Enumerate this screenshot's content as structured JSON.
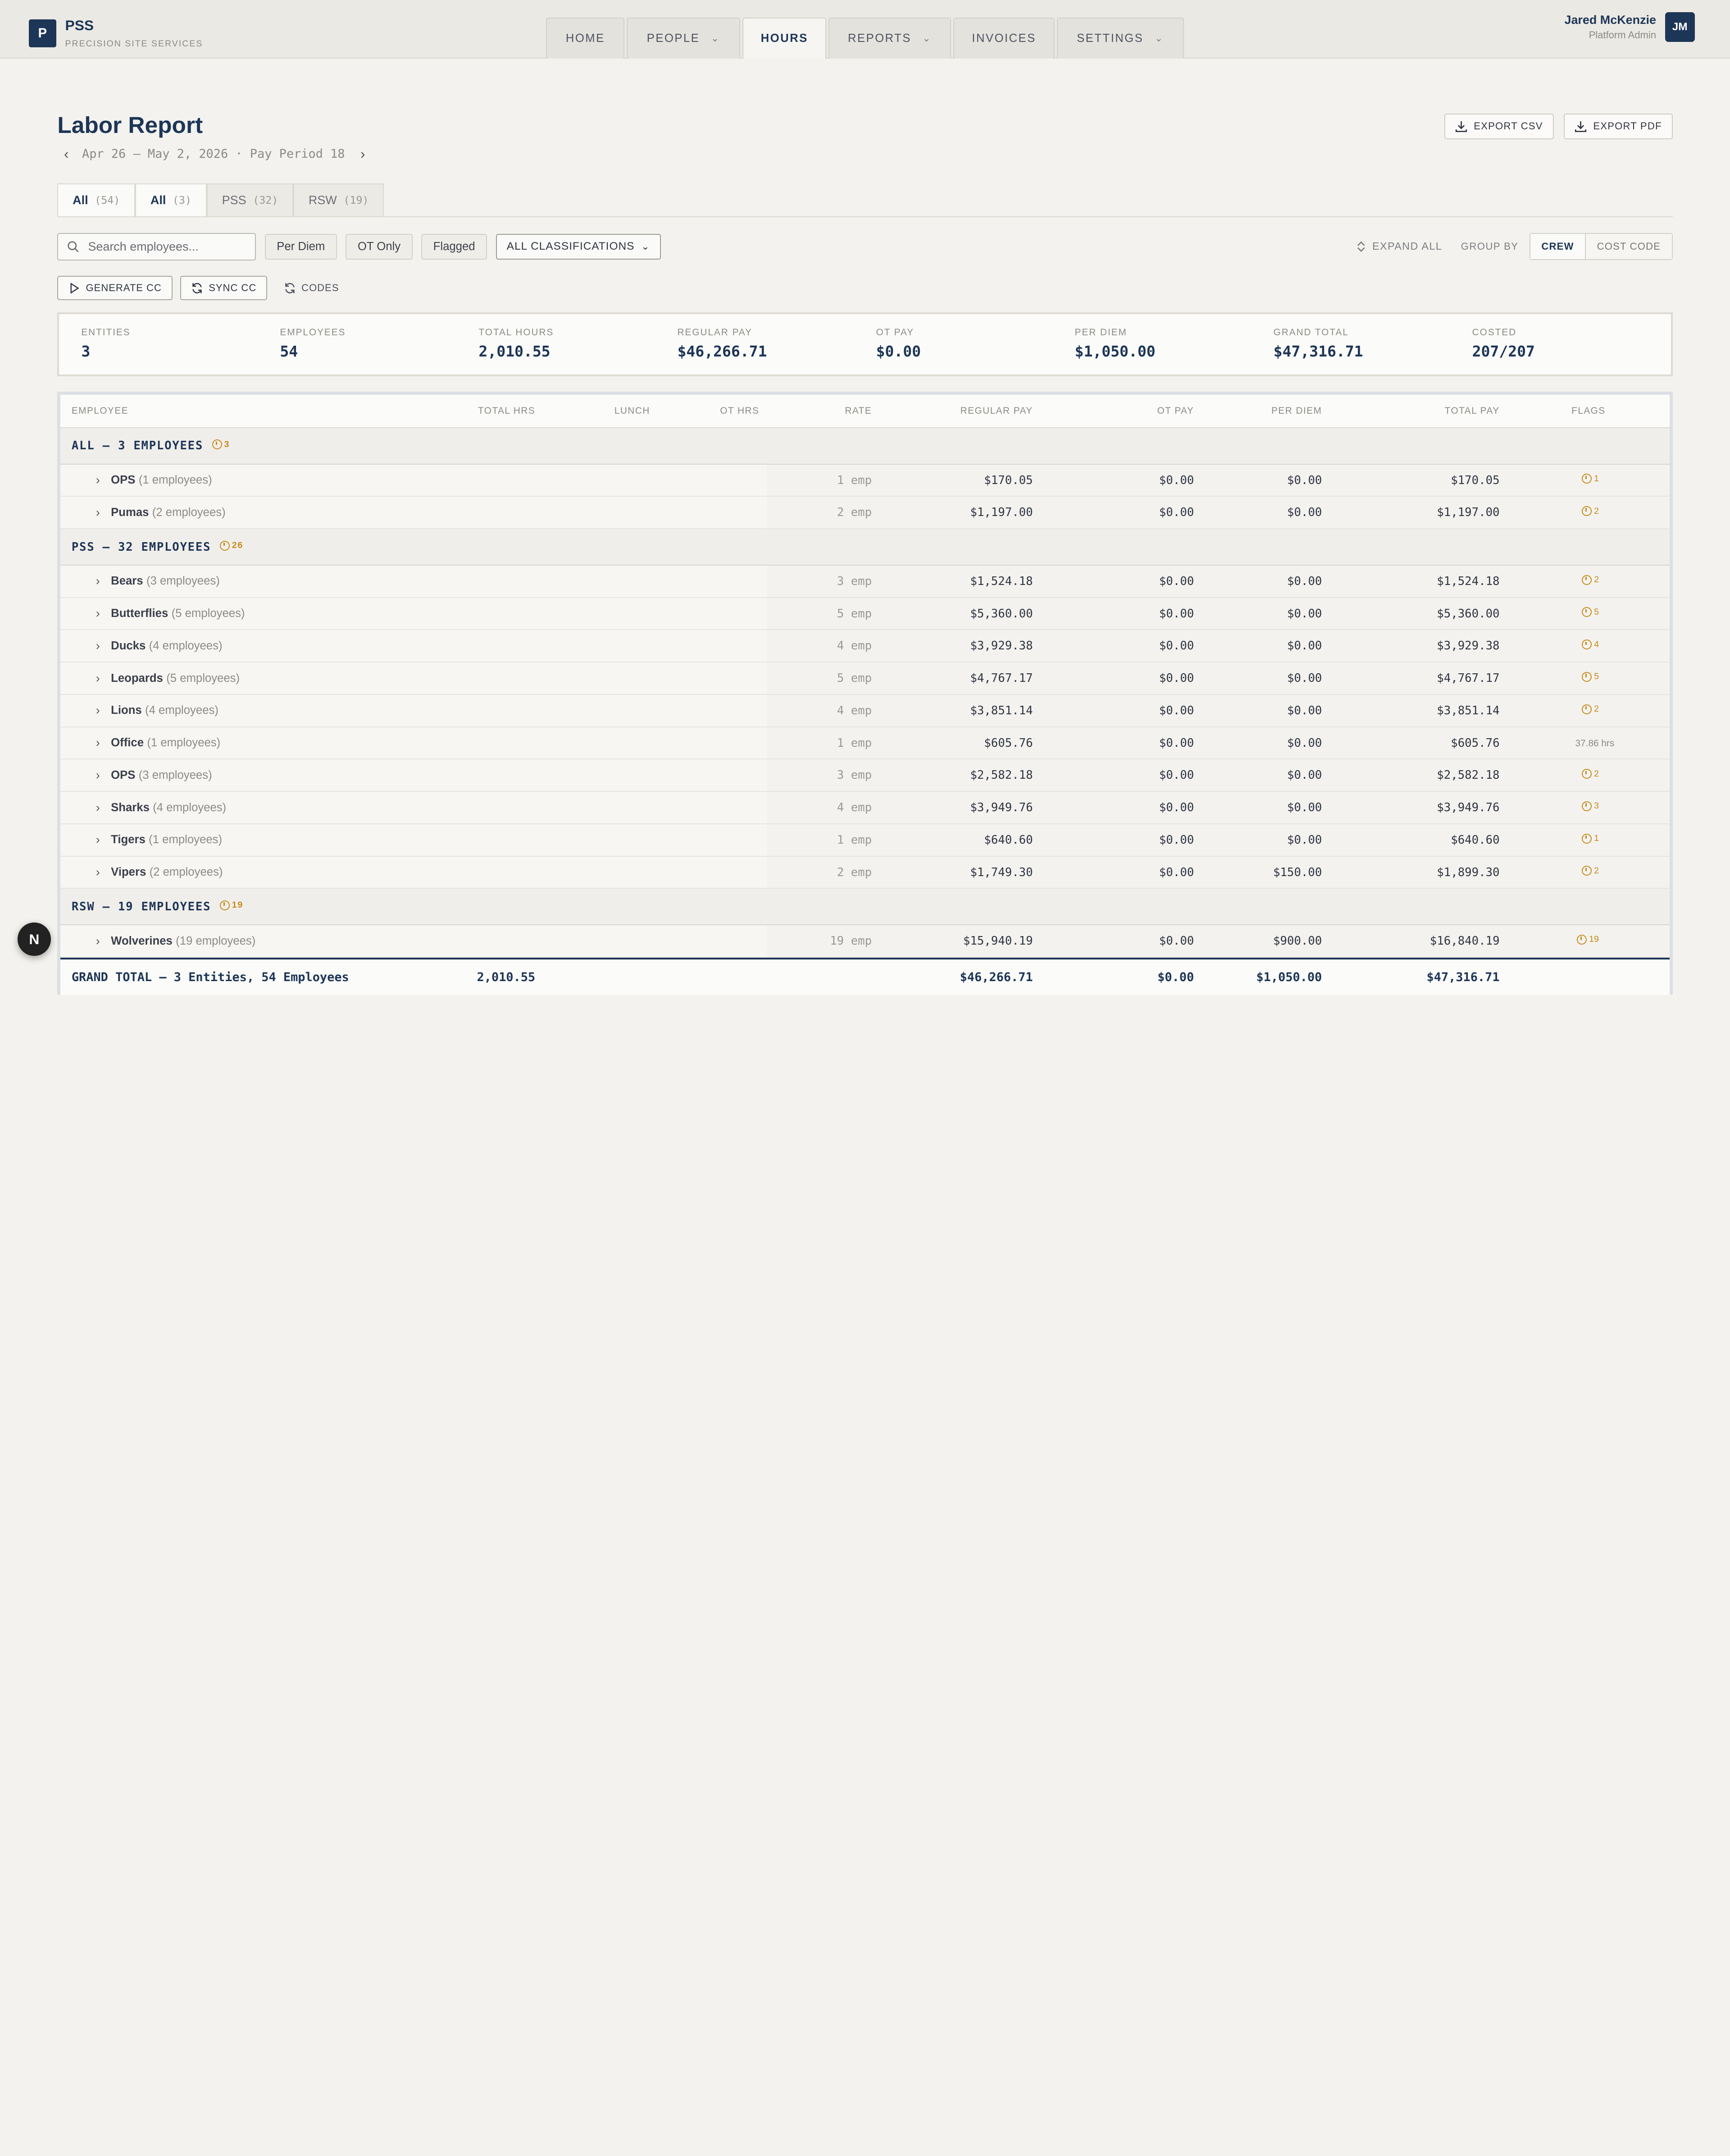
{
  "brand": {
    "logo_letter": "P",
    "name": "PSS",
    "subtitle": "PRECISION SITE SERVICES"
  },
  "nav": [
    {
      "label": "HOME",
      "dropdown": false,
      "active": false
    },
    {
      "label": "PEOPLE",
      "dropdown": true,
      "active": false
    },
    {
      "label": "HOURS",
      "dropdown": false,
      "active": true
    },
    {
      "label": "REPORTS",
      "dropdown": true,
      "active": false
    },
    {
      "label": "INVOICES",
      "dropdown": false,
      "active": false
    },
    {
      "label": "SETTINGS",
      "dropdown": true,
      "active": false
    }
  ],
  "user": {
    "name": "Jared McKenzie",
    "role": "Platform Admin",
    "initials": "JM"
  },
  "page": {
    "title": "Labor Report",
    "period": "Apr 26 – May 2, 2026 · Pay Period 18"
  },
  "exports": {
    "csv": "EXPORT CSV",
    "pdf": "EXPORT PDF"
  },
  "entity_tabs": [
    {
      "label": "All",
      "count": "(54)",
      "active": true
    },
    {
      "label": "All",
      "count": "(3)",
      "active": true
    },
    {
      "label": "PSS",
      "count": "(32)",
      "active": false
    },
    {
      "label": "RSW",
      "count": "(19)",
      "active": false
    }
  ],
  "filters": {
    "search_placeholder": "Search employees...",
    "chips": [
      "Per Diem",
      "OT Only",
      "Flagged"
    ],
    "classification": "ALL CLASSIFICATIONS",
    "expand_all": "EXPAND ALL",
    "group_by_label": "GROUP BY",
    "group_by_options": [
      "CREW",
      "COST CODE"
    ]
  },
  "actions": {
    "generate": "GENERATE CC",
    "sync": "SYNC CC",
    "codes": "CODES"
  },
  "summary": [
    {
      "label": "ENTITIES",
      "value": "3"
    },
    {
      "label": "EMPLOYEES",
      "value": "54"
    },
    {
      "label": "TOTAL HOURS",
      "value": "2,010.55"
    },
    {
      "label": "REGULAR PAY",
      "value": "$46,266.71"
    },
    {
      "label": "OT PAY",
      "value": "$0.00"
    },
    {
      "label": "PER DIEM",
      "value": "$1,050.00"
    },
    {
      "label": "GRAND TOTAL",
      "value": "$47,316.71"
    },
    {
      "label": "COSTED",
      "value": "207/207"
    }
  ],
  "table": {
    "columns": [
      "EMPLOYEE",
      "TOTAL HRS",
      "LUNCH",
      "OT HRS",
      "RATE",
      "REGULAR PAY",
      "OT PAY",
      "PER DIEM",
      "TOTAL PAY",
      "FLAGS"
    ],
    "groups": [
      {
        "title": "ALL — 3 EMPLOYEES",
        "flags": "3",
        "crews": [
          {
            "name": "OPS",
            "count": "(1 employees)",
            "rate": "1 emp",
            "regular": "$170.05",
            "ot": "$0.00",
            "per_diem": "$0.00",
            "total": "$170.05",
            "flag": "1",
            "flag_is_badge": true
          },
          {
            "name": "Pumas",
            "count": "(2 employees)",
            "rate": "2 emp",
            "regular": "$1,197.00",
            "ot": "$0.00",
            "per_diem": "$0.00",
            "total": "$1,197.00",
            "flag": "2",
            "flag_is_badge": true
          }
        ]
      },
      {
        "title": "PSS — 32 EMPLOYEES",
        "flags": "26",
        "crews": [
          {
            "name": "Bears",
            "count": "(3 employees)",
            "rate": "3 emp",
            "regular": "$1,524.18",
            "ot": "$0.00",
            "per_diem": "$0.00",
            "total": "$1,524.18",
            "flag": "2",
            "flag_is_badge": true
          },
          {
            "name": "Butterflies",
            "count": "(5 employees)",
            "rate": "5 emp",
            "regular": "$5,360.00",
            "ot": "$0.00",
            "per_diem": "$0.00",
            "total": "$5,360.00",
            "flag": "5",
            "flag_is_badge": true
          },
          {
            "name": "Ducks",
            "count": "(4 employees)",
            "rate": "4 emp",
            "regular": "$3,929.38",
            "ot": "$0.00",
            "per_diem": "$0.00",
            "total": "$3,929.38",
            "flag": "4",
            "flag_is_badge": true
          },
          {
            "name": "Leopards",
            "count": "(5 employees)",
            "rate": "5 emp",
            "regular": "$4,767.17",
            "ot": "$0.00",
            "per_diem": "$0.00",
            "total": "$4,767.17",
            "flag": "5",
            "flag_is_badge": true
          },
          {
            "name": "Lions",
            "count": "(4 employees)",
            "rate": "4 emp",
            "regular": "$3,851.14",
            "ot": "$0.00",
            "per_diem": "$0.00",
            "total": "$3,851.14",
            "flag": "2",
            "flag_is_badge": true
          },
          {
            "name": "Office",
            "count": "(1 employees)",
            "rate": "1 emp",
            "regular": "$605.76",
            "ot": "$0.00",
            "per_diem": "$0.00",
            "total": "$605.76",
            "flag": "37.86 hrs",
            "flag_is_badge": false
          },
          {
            "name": "OPS",
            "count": "(3 employees)",
            "rate": "3 emp",
            "regular": "$2,582.18",
            "ot": "$0.00",
            "per_diem": "$0.00",
            "total": "$2,582.18",
            "flag": "2",
            "flag_is_badge": true
          },
          {
            "name": "Sharks",
            "count": "(4 employees)",
            "rate": "4 emp",
            "regular": "$3,949.76",
            "ot": "$0.00",
            "per_diem": "$0.00",
            "total": "$3,949.76",
            "flag": "3",
            "flag_is_badge": true
          },
          {
            "name": "Tigers",
            "count": "(1 employees)",
            "rate": "1 emp",
            "regular": "$640.60",
            "ot": "$0.00",
            "per_diem": "$0.00",
            "total": "$640.60",
            "flag": "1",
            "flag_is_badge": true
          },
          {
            "name": "Vipers",
            "count": "(2 employees)",
            "rate": "2 emp",
            "regular": "$1,749.30",
            "ot": "$0.00",
            "per_diem": "$150.00",
            "total": "$1,899.30",
            "flag": "2",
            "flag_is_badge": true
          }
        ]
      },
      {
        "title": "RSW — 19 EMPLOYEES",
        "flags": "19",
        "crews": [
          {
            "name": "Wolverines",
            "count": "(19 employees)",
            "rate": "19 emp",
            "regular": "$15,940.19",
            "ot": "$0.00",
            "per_diem": "$900.00",
            "total": "$16,840.19",
            "flag": "19",
            "flag_is_badge": true
          }
        ]
      }
    ],
    "grand_total": {
      "label": "GRAND TOTAL — 3 Entities, 54 Employees",
      "hours": "2,010.55",
      "regular": "$46,266.71",
      "ot": "$0.00",
      "per_diem": "$1,050.00",
      "total": "$47,316.71"
    }
  },
  "fab_label": "N",
  "colors": {
    "primary": "#1d3557",
    "flag": "#c98a1a",
    "background": "#f3f2ee"
  }
}
